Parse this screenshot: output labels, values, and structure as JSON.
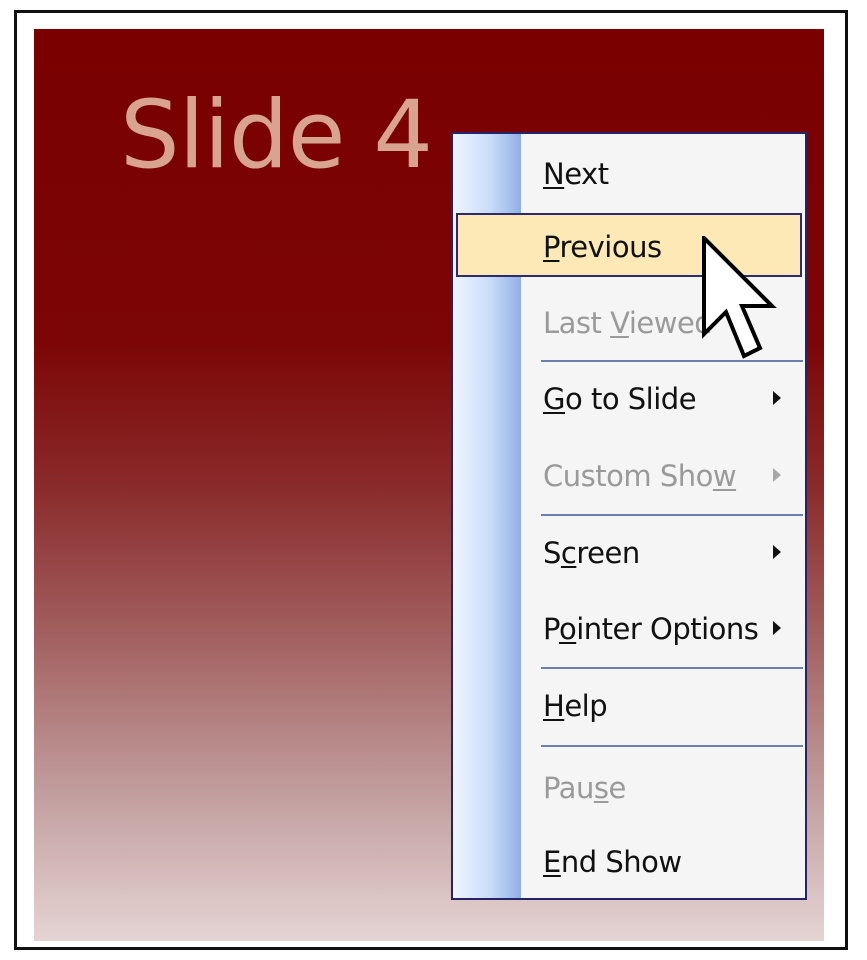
{
  "slide": {
    "title": "Slide 4"
  },
  "menu": {
    "items": [
      {
        "label_pre": "",
        "mnemonic": "N",
        "label_post": "ext",
        "enabled": true,
        "submenu": false
      },
      {
        "label_pre": "",
        "mnemonic": "P",
        "label_post": "revious",
        "enabled": true,
        "submenu": false,
        "highlighted": true
      },
      {
        "label_pre": "Last ",
        "mnemonic": "V",
        "label_post": "iewed",
        "enabled": false,
        "submenu": false
      },
      {
        "label_pre": "",
        "mnemonic": "G",
        "label_post": "o to Slide",
        "enabled": true,
        "submenu": true
      },
      {
        "label_pre": "Custom Sho",
        "mnemonic": "w",
        "label_post": "",
        "enabled": false,
        "submenu": true
      },
      {
        "label_pre": "S",
        "mnemonic": "c",
        "label_post": "reen",
        "enabled": true,
        "submenu": true
      },
      {
        "label_pre": "P",
        "mnemonic": "o",
        "label_post": "inter Options",
        "enabled": true,
        "submenu": true
      },
      {
        "label_pre": "",
        "mnemonic": "H",
        "label_post": "elp",
        "enabled": true,
        "submenu": false
      },
      {
        "label_pre": "Pau",
        "mnemonic": "s",
        "label_post": "e",
        "enabled": false,
        "submenu": false
      },
      {
        "label_pre": "",
        "mnemonic": "E",
        "label_post": "nd Show",
        "enabled": true,
        "submenu": false
      }
    ]
  },
  "colors": {
    "slide_top": "#7a0000",
    "slide_title": "#d8a48f",
    "menu_border": "#25236a",
    "highlight": "#fde9b5"
  },
  "icons": {
    "cursor": "mouse-pointer-icon",
    "submenu": "submenu-arrow-icon"
  }
}
